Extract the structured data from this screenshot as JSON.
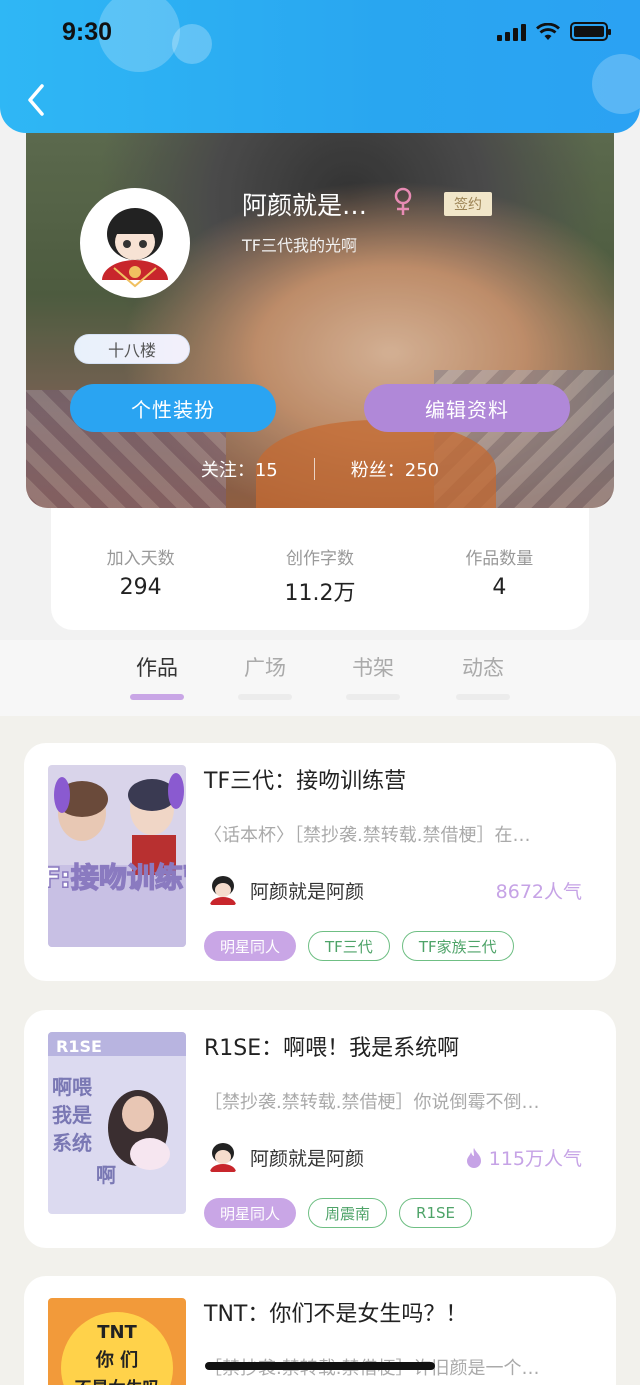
{
  "status_bar": {
    "time": "9:30"
  },
  "profile": {
    "name": "阿颜就是…",
    "signed_badge": "签约",
    "subtitle": "TF三代我的光啊",
    "floor_badge": "十八楼",
    "dress_button": "个性装扮",
    "edit_button": "编辑资料",
    "following": "关注：15",
    "followers": "粉丝：250",
    "gender": "female"
  },
  "stats": [
    {
      "label": "加入天数",
      "value": "294"
    },
    {
      "label": "创作字数",
      "value": "11.2万"
    },
    {
      "label": "作品数量",
      "value": "4"
    }
  ],
  "tabs": [
    {
      "label": "作品",
      "active": true
    },
    {
      "label": "广场",
      "active": false
    },
    {
      "label": "书架",
      "active": false
    },
    {
      "label": "动态",
      "active": false
    }
  ],
  "books": [
    {
      "title": "TF三代：接吻训练营",
      "desc": "〈话本杯〉［禁抄袭.禁转载.禁借梗］在…",
      "author": "阿颜就是阿颜",
      "popularity": "8672人气",
      "hot": false,
      "cover_text": "TF:接吻训练营",
      "tags": [
        "明星同人",
        "TF三代",
        "TF家族三代"
      ]
    },
    {
      "title": "R1SE：啊喂！我是系统啊",
      "desc": "［禁抄袭.禁转载.禁借梗］你说倒霉不倒…",
      "author": "阿颜就是阿颜",
      "popularity": "115万人气",
      "hot": true,
      "cover_text": "R1SE 啊喂我是系统啊",
      "tags": [
        "明星同人",
        "周震南",
        "R1SE"
      ]
    },
    {
      "title": "TNT：你们不是女生吗？！",
      "desc": "［禁抄袭.禁转载.禁借梗］许旧颜是一个…",
      "cover_text": "TNT 你们不是女生吗"
    }
  ],
  "colors": {
    "header": "#2ba8f2",
    "accent_purple": "#c9a6e6",
    "accent_blue": "#2aa4f2",
    "tag_green": "#6fbf84"
  }
}
